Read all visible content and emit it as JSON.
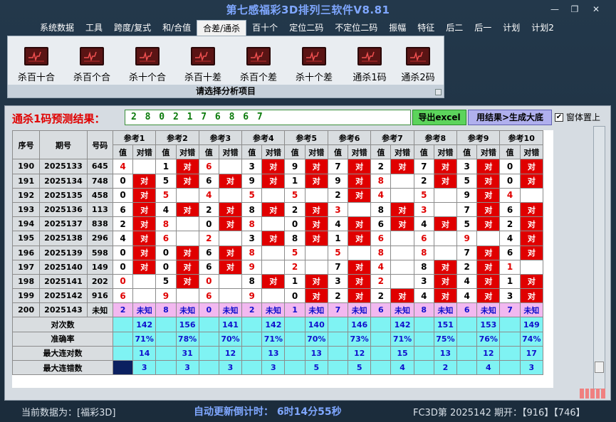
{
  "window": {
    "title": "第七感福彩3D排列三软件V8.81",
    "min": "—",
    "restore": "❐",
    "close": "✕"
  },
  "menu": [
    "系统数据",
    "工具",
    "跨度/复式",
    "和/合值",
    "合差/通杀",
    "百十个",
    "定位二码",
    "不定位二码",
    "振幅",
    "特征",
    "后二",
    "后一",
    "计划",
    "计划2"
  ],
  "menu_active_index": 4,
  "ribbon": {
    "buttons": [
      "杀百十合",
      "杀百个合",
      "杀十个合",
      "杀百十差",
      "杀百个差",
      "杀十个差",
      "通杀1码",
      "通杀2码"
    ],
    "icon": "heartbeat-chart-icon",
    "caption": "请选择分析项目"
  },
  "prediction": {
    "label": "通杀1码预测结果：",
    "value": "2 8 0 2 1 7 6 8 6 7",
    "export_button": "导出excel",
    "large_button": "用结果>生成大底",
    "checkbox_label": "窗体置上",
    "checkbox_checked": true
  },
  "table": {
    "headers": {
      "seq": "序号",
      "period": "期号",
      "number": "号码"
    },
    "refs": [
      "参考1",
      "参考2",
      "参考3",
      "参考4",
      "参考5",
      "参考6",
      "参考7",
      "参考8",
      "参考9",
      "参考10"
    ],
    "sub_headers": [
      "值",
      "对错"
    ],
    "hit_text": "对",
    "rows": [
      {
        "seq": "190",
        "period": "2025133",
        "num": "645",
        "cells": [
          [
            "4",
            "0",
            1
          ],
          [
            "1",
            "1",
            0
          ],
          [
            "6",
            "0",
            1
          ],
          [
            "3",
            "1",
            0
          ],
          [
            "9",
            "1",
            0
          ],
          [
            "7",
            "1",
            0
          ],
          [
            "2",
            "1",
            0
          ],
          [
            "7",
            "1",
            0
          ],
          [
            "3",
            "1",
            0
          ],
          [
            "0",
            "1",
            0
          ]
        ]
      },
      {
        "seq": "191",
        "period": "2025134",
        "num": "748",
        "cells": [
          [
            "0",
            "1",
            0
          ],
          [
            "5",
            "1",
            0
          ],
          [
            "6",
            "1",
            0
          ],
          [
            "9",
            "1",
            0
          ],
          [
            "1",
            "1",
            0
          ],
          [
            "9",
            "1",
            0
          ],
          [
            "8",
            "0",
            1
          ],
          [
            "2",
            "1",
            0
          ],
          [
            "5",
            "1",
            0
          ],
          [
            "0",
            "1",
            0
          ]
        ]
      },
      {
        "seq": "192",
        "period": "2025135",
        "num": "458",
        "cells": [
          [
            "0",
            "1",
            0
          ],
          [
            "5",
            "0",
            1
          ],
          [
            "4",
            "0",
            1
          ],
          [
            "5",
            "0",
            1
          ],
          [
            "5",
            "0",
            1
          ],
          [
            "2",
            "1",
            0
          ],
          [
            "4",
            "0",
            1
          ],
          [
            "5",
            "0",
            1
          ],
          [
            "9",
            "1",
            0
          ],
          [
            "4",
            "0",
            1
          ]
        ]
      },
      {
        "seq": "193",
        "period": "2025136",
        "num": "113",
        "cells": [
          [
            "6",
            "1",
            0
          ],
          [
            "4",
            "1",
            0
          ],
          [
            "2",
            "1",
            0
          ],
          [
            "8",
            "1",
            0
          ],
          [
            "2",
            "1",
            0
          ],
          [
            "3",
            "0",
            1
          ],
          [
            "8",
            "1",
            0
          ],
          [
            "3",
            "0",
            1
          ],
          [
            "7",
            "1",
            0
          ],
          [
            "6",
            "1",
            0
          ]
        ]
      },
      {
        "seq": "194",
        "period": "2025137",
        "num": "838",
        "cells": [
          [
            "2",
            "1",
            0
          ],
          [
            "8",
            "0",
            1
          ],
          [
            "0",
            "1",
            0
          ],
          [
            "8",
            "0",
            1
          ],
          [
            "0",
            "1",
            0
          ],
          [
            "4",
            "1",
            0
          ],
          [
            "6",
            "1",
            0
          ],
          [
            "4",
            "1",
            0
          ],
          [
            "5",
            "1",
            0
          ],
          [
            "2",
            "1",
            0
          ]
        ]
      },
      {
        "seq": "195",
        "period": "2025138",
        "num": "296",
        "cells": [
          [
            "4",
            "1",
            0
          ],
          [
            "6",
            "0",
            1
          ],
          [
            "2",
            "0",
            1
          ],
          [
            "3",
            "1",
            0
          ],
          [
            "8",
            "1",
            0
          ],
          [
            "1",
            "1",
            0
          ],
          [
            "6",
            "0",
            1
          ],
          [
            "6",
            "0",
            1
          ],
          [
            "9",
            "0",
            1
          ],
          [
            "4",
            "1",
            0
          ]
        ]
      },
      {
        "seq": "196",
        "period": "2025139",
        "num": "598",
        "cells": [
          [
            "0",
            "1",
            0
          ],
          [
            "0",
            "1",
            0
          ],
          [
            "6",
            "1",
            0
          ],
          [
            "8",
            "0",
            1
          ],
          [
            "5",
            "0",
            1
          ],
          [
            "5",
            "0",
            1
          ],
          [
            "8",
            "0",
            1
          ],
          [
            "8",
            "0",
            1
          ],
          [
            "7",
            "1",
            0
          ],
          [
            "6",
            "1",
            0
          ]
        ]
      },
      {
        "seq": "197",
        "period": "2025140",
        "num": "149",
        "cells": [
          [
            "0",
            "1",
            0
          ],
          [
            "0",
            "1",
            0
          ],
          [
            "6",
            "1",
            0
          ],
          [
            "9",
            "0",
            1
          ],
          [
            "2",
            "0",
            1
          ],
          [
            "7",
            "1",
            0
          ],
          [
            "4",
            "0",
            1
          ],
          [
            "8",
            "1",
            0
          ],
          [
            "2",
            "1",
            0
          ],
          [
            "1",
            "0",
            1
          ]
        ]
      },
      {
        "seq": "198",
        "period": "2025141",
        "num": "202",
        "cells": [
          [
            "0",
            "0",
            1
          ],
          [
            "5",
            "1",
            0
          ],
          [
            "0",
            "0",
            1
          ],
          [
            "8",
            "1",
            0
          ],
          [
            "1",
            "1",
            0
          ],
          [
            "3",
            "1",
            0
          ],
          [
            "2",
            "0",
            1
          ],
          [
            "3",
            "1",
            0
          ],
          [
            "4",
            "1",
            0
          ],
          [
            "1",
            "1",
            0
          ]
        ]
      },
      {
        "seq": "199",
        "period": "2025142",
        "num": "916",
        "cells": [
          [
            "6",
            "0",
            1
          ],
          [
            "9",
            "0",
            1
          ],
          [
            "6",
            "0",
            1
          ],
          [
            "9",
            "0",
            1
          ],
          [
            "0",
            "1",
            0
          ],
          [
            "2",
            "1",
            0
          ],
          [
            "2",
            "1",
            0
          ],
          [
            "4",
            "1",
            0
          ],
          [
            "4",
            "1",
            0
          ],
          [
            "3",
            "1",
            0
          ]
        ]
      }
    ],
    "future_row": {
      "seq": "200",
      "period": "2025143",
      "num": "未知",
      "values": [
        "2",
        "8",
        "0",
        "2",
        "1",
        "7",
        "6",
        "8",
        "6",
        "7"
      ],
      "status": "未知"
    },
    "stats": [
      {
        "label": "对次数",
        "values": [
          "142",
          "156",
          "141",
          "142",
          "140",
          "146",
          "142",
          "151",
          "153",
          "149"
        ]
      },
      {
        "label": "准确率",
        "values": [
          "71%",
          "78%",
          "70%",
          "71%",
          "70%",
          "73%",
          "71%",
          "75%",
          "76%",
          "74%"
        ]
      },
      {
        "label": "最大连对数",
        "values": [
          "14",
          "31",
          "12",
          "13",
          "13",
          "12",
          "15",
          "13",
          "12",
          "17"
        ]
      },
      {
        "label": "最大连错数",
        "values": [
          "3",
          "3",
          "3",
          "3",
          "5",
          "5",
          "4",
          "2",
          "4",
          "3"
        ]
      }
    ],
    "colors": {
      "hit": "#e00000",
      "future": "#f2b8f0",
      "stats": "#7ff3f3",
      "header": "#d9dde0"
    }
  },
  "status": {
    "data_label": "当前数据为：[福彩3D]",
    "countdown": "自动更新倒计时：  6时14分55秒",
    "issue": "FC3D第 2025142 期开：【916】【746】"
  }
}
